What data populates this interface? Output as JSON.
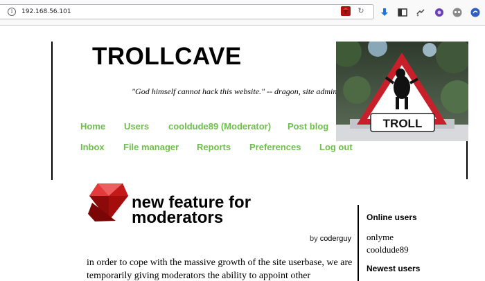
{
  "browser": {
    "url": "192.168.56.101",
    "icons": [
      "ruby-addon-icon",
      "reload-icon",
      "download-icon",
      "sidebar-icon",
      "extension-icon",
      "puzzle-icon",
      "privacy-icon",
      "sync-icon"
    ]
  },
  "site": {
    "title": "TROLLCAVE",
    "tagline": "\"God himself cannot hack this website.\" -- dragon, site admin",
    "nav_row1": [
      "Home",
      "Users",
      "cooldude89 (Moderator)",
      "Post blog"
    ],
    "nav_row2": [
      "Inbox",
      "File manager",
      "Reports",
      "Preferences",
      "Log out"
    ],
    "sign_text": "TROLL",
    "link_color": "#6cc04a"
  },
  "post": {
    "title_line1": "new feature for",
    "title_line2": "moderators",
    "by_label": "by",
    "author": "coderguy",
    "body": "in order to cope with the massive growth of the site userbase, we are temporarily giving moderators the ability to appoint other"
  },
  "sidebar": {
    "online_heading": "Online users",
    "online_users": [
      "onlyme",
      "cooldude89"
    ],
    "newest_heading": "Newest users"
  }
}
